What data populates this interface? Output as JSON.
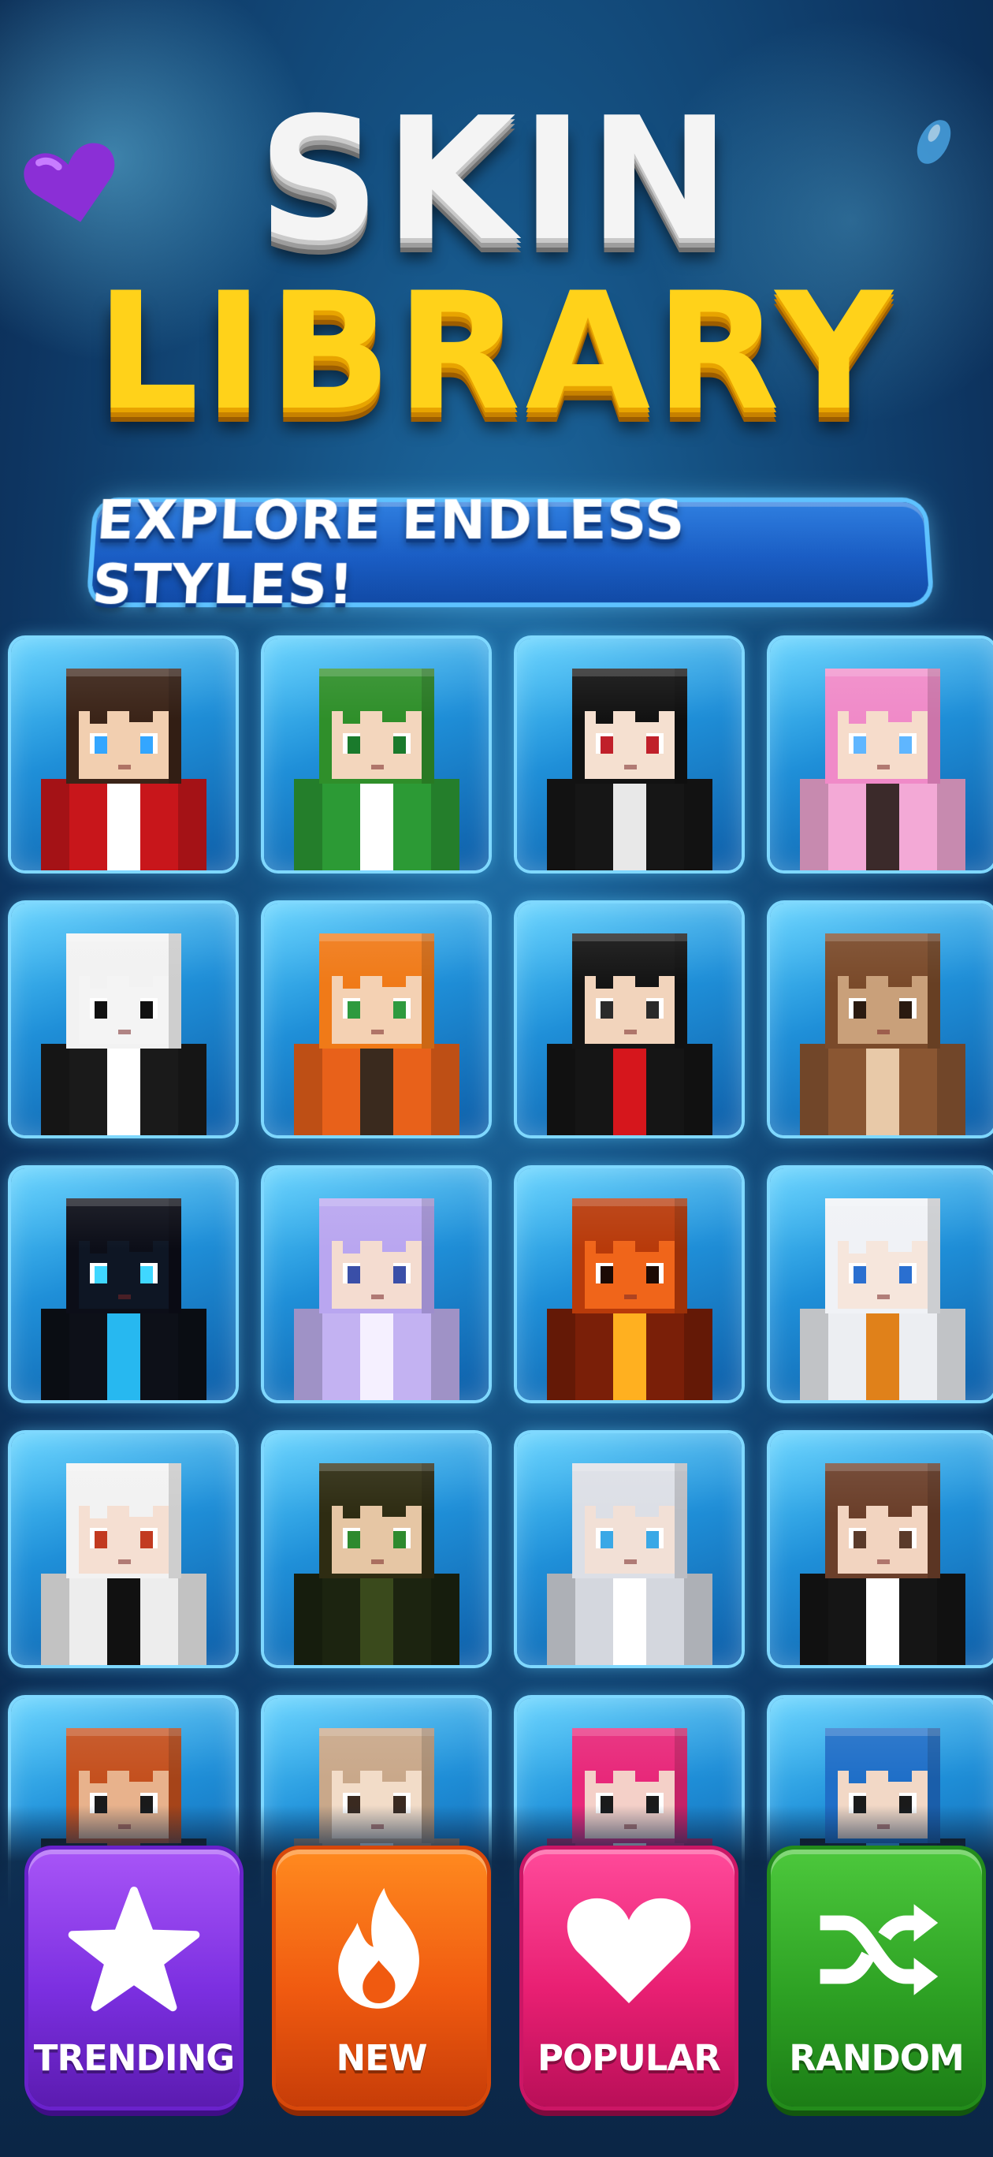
{
  "title": {
    "line1": "SKIN",
    "line2": "LIBRARY",
    "subtitle": "EXPLORE ENDLESS STYLES!"
  },
  "decorations": {
    "heart_color": "#8b2fd6",
    "accent_glow": "#6fd3ff"
  },
  "skins": [
    {
      "name": "red-hoodie-boy-skin",
      "hair": "#3b2418",
      "body": "#c8161b",
      "skin": "#f2cfb0",
      "eyes": "#33a6ff",
      "accent": "#ffffff"
    },
    {
      "name": "green-frog-hood-girl-skin",
      "hair": "#2f8f2a",
      "body": "#2c9a35",
      "skin": "#f3d6bd",
      "eyes": "#1a7a2c",
      "accent": "#ffffff"
    },
    {
      "name": "black-hair-skeleton-shirt-skin",
      "hair": "#121212",
      "body": "#161616",
      "skin": "#f5e0d0",
      "eyes": "#c0202a",
      "accent": "#e8e8e8"
    },
    {
      "name": "pink-hair-girl-skin",
      "hair": "#f08ac8",
      "body": "#f3a9d6",
      "skin": "#f6dccb",
      "eyes": "#5fb6ff",
      "accent": "#3b2a2a"
    },
    {
      "name": "panda-skin",
      "hair": "#f2f2f2",
      "body": "#1a1a1a",
      "skin": "#f4f4f4",
      "eyes": "#111111",
      "accent": "#ffffff"
    },
    {
      "name": "orange-fox-hoodie-skin",
      "hair": "#f07a18",
      "body": "#e8611a",
      "skin": "#f4d1b3",
      "eyes": "#2e9a3e",
      "accent": "#3a2a1e"
    },
    {
      "name": "black-suit-red-tie-skin",
      "hair": "#141414",
      "body": "#151515",
      "skin": "#f2d4bc",
      "eyes": "#2a2a2a",
      "accent": "#d6161c"
    },
    {
      "name": "brown-bear-skin",
      "hair": "#7a4a2a",
      "body": "#8a5632",
      "skin": "#c9a07a",
      "eyes": "#2a1a10",
      "accent": "#e8c9a8"
    },
    {
      "name": "dark-glowing-cyan-skin",
      "hair": "#0c0e18",
      "body": "#0d1018",
      "skin": "#0e1624",
      "eyes": "#3fd7ff",
      "accent": "#27b8f0"
    },
    {
      "name": "lavender-hair-girl-skin",
      "hair": "#b9a6f0",
      "body": "#c3b2f2",
      "skin": "#f4dcd0",
      "eyes": "#3a4fa8",
      "accent": "#f5f0ff"
    },
    {
      "name": "fire-lava-skin",
      "hair": "#b83a0a",
      "body": "#7a1f08",
      "skin": "#f0651a",
      "eyes": "#1c0a05",
      "accent": "#ffb020"
    },
    {
      "name": "white-hair-orange-tie-skin",
      "hair": "#f0f2f6",
      "body": "#eceef2",
      "skin": "#f6e6dc",
      "eyes": "#2a6fd0",
      "accent": "#e0811a"
    },
    {
      "name": "white-hair-black-jacket-skin",
      "hair": "#f2f2f2",
      "body": "#ededed",
      "skin": "#f5dfd2",
      "eyes": "#c23a20",
      "accent": "#111111"
    },
    {
      "name": "olive-hoodie-boy-skin",
      "hair": "#2e2c12",
      "body": "#1c2410",
      "skin": "#e6c6a4",
      "eyes": "#2e8a2e",
      "accent": "#3a4a1c"
    },
    {
      "name": "silver-hair-girl-skin",
      "hair": "#dcdfe6",
      "body": "#d4d7de",
      "skin": "#f2e0d6",
      "eyes": "#3aa8e6",
      "accent": "#ffffff"
    },
    {
      "name": "brown-hair-black-top-skin",
      "hair": "#6b3f2a",
      "body": "#151515",
      "skin": "#f2d4c0",
      "eyes": "#5a3a2a",
      "accent": "#ffffff"
    },
    {
      "name": "ginger-boy-skin",
      "hair": "#c4501e",
      "body": "#1a1a1a",
      "skin": "#e8b28c",
      "eyes": "#1a1a1a",
      "accent": "#c4501e"
    },
    {
      "name": "beige-hair-skin",
      "hair": "#c9a88a",
      "body": "#c9a88a",
      "skin": "#f2dcc8",
      "eyes": "#3a2a20",
      "accent": "#ffffff"
    },
    {
      "name": "magenta-hair-skin",
      "hair": "#e8287a",
      "body": "#e8287a",
      "skin": "#f4d0c8",
      "eyes": "#1a1a1a",
      "accent": "#ffffff"
    },
    {
      "name": "blue-pixel-camo-skin",
      "hair": "#1f6fc8",
      "body": "#1a1a1a",
      "skin": "#f2d8c6",
      "eyes": "#1a1a1a",
      "accent": "#3fb8ff"
    }
  ],
  "buttons": [
    {
      "label": "TRENDING",
      "icon": "star-icon"
    },
    {
      "label": "NEW",
      "icon": "fire-icon"
    },
    {
      "label": "POPULAR",
      "icon": "heart-icon"
    },
    {
      "label": "RANDOM",
      "icon": "shuffle-icon"
    }
  ]
}
